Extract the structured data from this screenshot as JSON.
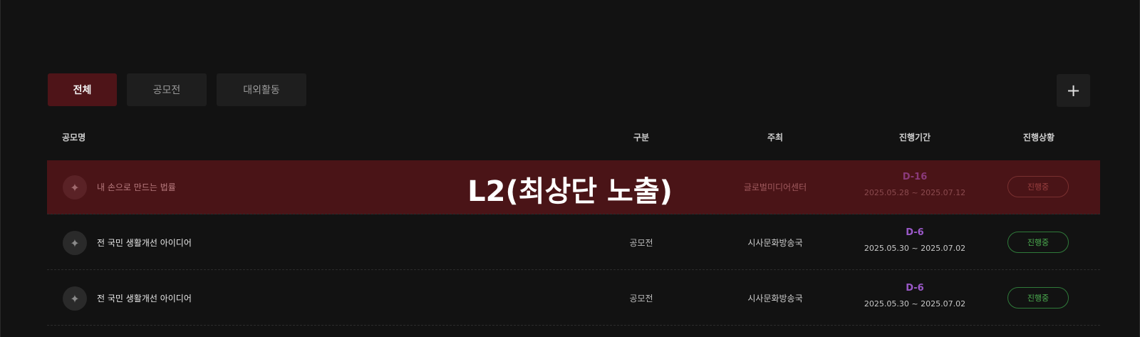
{
  "tabs": [
    {
      "label": "전체",
      "active": true
    },
    {
      "label": "공모전",
      "active": false
    },
    {
      "label": "대외활동",
      "active": false
    }
  ],
  "add_button": {
    "label": "+"
  },
  "columns": {
    "name": "공모명",
    "type": "구분",
    "host": "주최",
    "period": "진행기간",
    "status": "진행상황"
  },
  "rows": [
    {
      "name": "내 손으로 만드는 법률",
      "type": "",
      "host": "글로벌미디어센터",
      "dday": "D-16",
      "dates": "2025.05.28 ~ 2025.07.12",
      "status": "진행중",
      "highlighted": true
    },
    {
      "name": "전 국민 생활개선 아이디어",
      "type": "공모전",
      "host": "시사문화방송국",
      "dday": "D-6",
      "dates": "2025.05.30 ~ 2025.07.02",
      "status": "진행중",
      "highlighted": false
    },
    {
      "name": "전 국민 생활개선 아이디어",
      "type": "공모전",
      "host": "시사문화방송국",
      "dday": "D-6",
      "dates": "2025.05.30 ~ 2025.07.02",
      "status": "진행중",
      "highlighted": false
    }
  ],
  "overlay_label": "L2(최상단 노출)",
  "colors": {
    "background": "#121212",
    "active_tab": "#4e1418",
    "highlight_row": "#4a1417",
    "dday": "#9b59c9",
    "status_green": "#4caf50"
  },
  "icons": {
    "logo": "bird-logo-icon",
    "add": "plus-icon"
  }
}
